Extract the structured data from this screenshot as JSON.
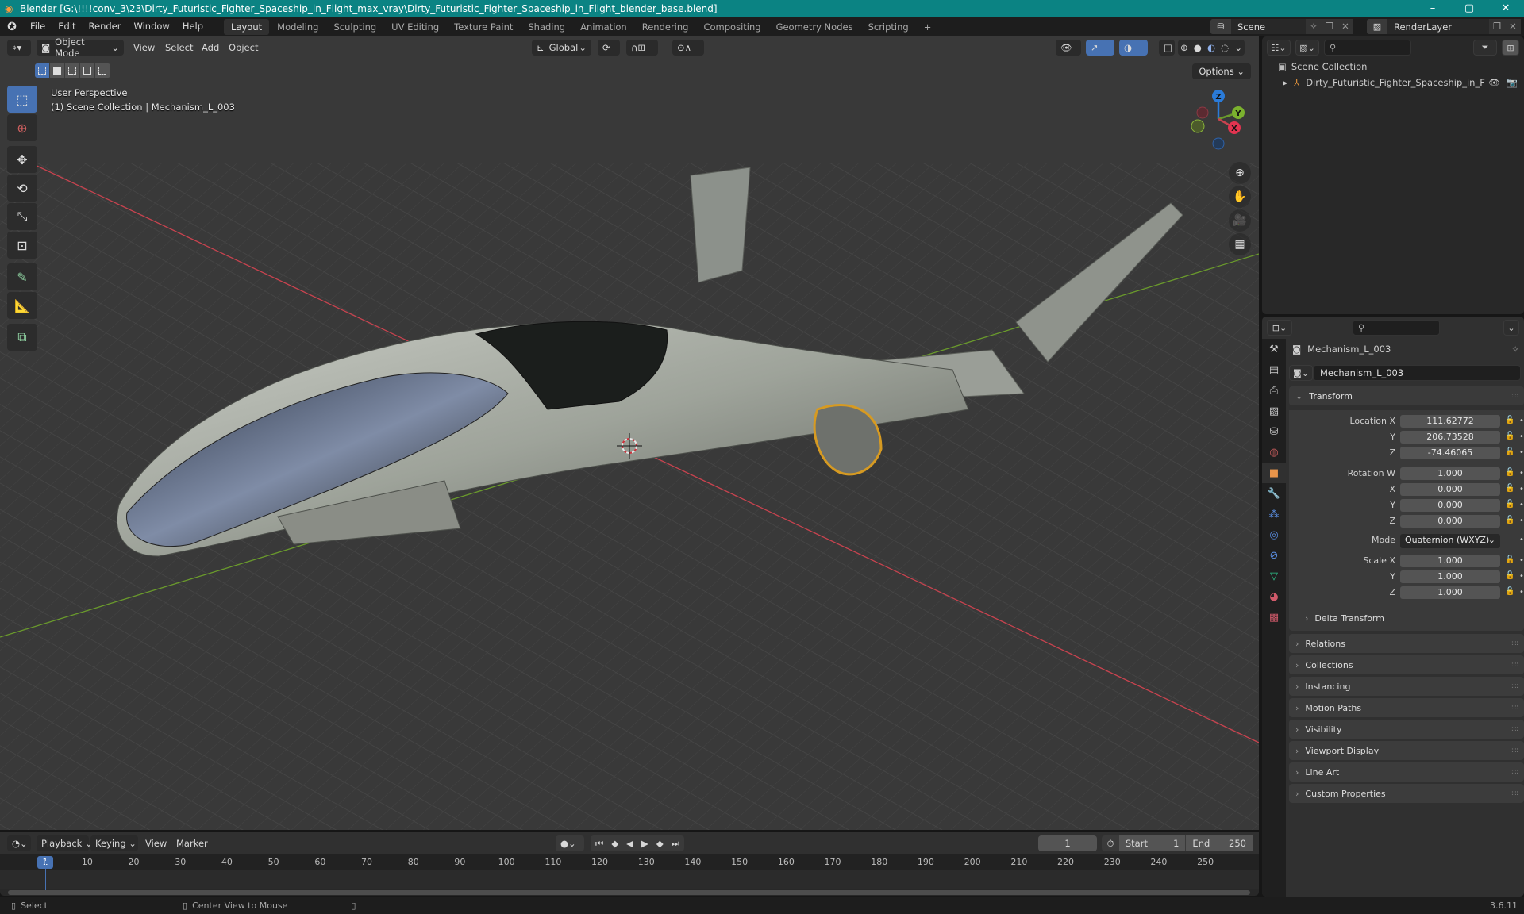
{
  "titlebar": {
    "title": "Blender [G:\\!!!!conv_3\\23\\Dirty_Futuristic_Fighter_Spaceship_in_Flight_max_vray\\Dirty_Futuristic_Fighter_Spaceship_in_Flight_blender_base.blend]",
    "minimize": "–",
    "maximize": "▢",
    "close": "✕"
  },
  "menubar": {
    "menus": [
      "File",
      "Edit",
      "Render",
      "Window",
      "Help"
    ],
    "workspaces": [
      "Layout",
      "Modeling",
      "Sculpting",
      "UV Editing",
      "Texture Paint",
      "Shading",
      "Animation",
      "Rendering",
      "Compositing",
      "Geometry Nodes",
      "Scripting"
    ],
    "active_workspace": "Layout",
    "add_workspace": "+",
    "scene": "Scene",
    "view_layer": "RenderLayer"
  },
  "viewport": {
    "mode": "Object Mode",
    "menus": [
      "View",
      "Select",
      "Add",
      "Object"
    ],
    "orientation": "Global",
    "options_label": "Options",
    "overlay_line1": "User Perspective",
    "overlay_line2": "(1) Scene Collection | Mechanism_L_003",
    "gizmo_axes": {
      "x": "X",
      "y": "Y",
      "z": "Z"
    },
    "colors": {
      "x_axis": "#c8434f",
      "y_axis": "#6a9a2c",
      "z_axis": "#2a7bd9",
      "select_blue": "#4772b3"
    }
  },
  "outliner": {
    "root": "Scene Collection",
    "items": [
      {
        "name": "Dirty_Futuristic_Fighter_Spaceship_in_F"
      }
    ]
  },
  "properties": {
    "object_name": "Mechanism_L_003",
    "data_name": "Mechanism_L_003",
    "transform_label": "Transform",
    "location": {
      "label": "Location X",
      "x": "111.62772",
      "y": "206.73528",
      "z": "-74.46065"
    },
    "rotation": {
      "label": "Rotation W",
      "w": "1.000",
      "x": "0.000",
      "y": "0.000",
      "z": "0.000"
    },
    "mode_label": "Mode",
    "mode_value": "Quaternion (WXYZ)",
    "scale": {
      "label": "Scale X",
      "x": "1.000",
      "y": "1.000",
      "z": "1.000"
    },
    "axis_labels": {
      "y": "Y",
      "z": "Z",
      "x": "X"
    },
    "delta_transform": "Delta Transform",
    "panels": [
      "Relations",
      "Collections",
      "Instancing",
      "Motion Paths",
      "Visibility",
      "Viewport Display",
      "Line Art",
      "Custom Properties"
    ]
  },
  "timeline": {
    "menus": [
      "Playback",
      "Keying",
      "View",
      "Marker"
    ],
    "current_frame": "1",
    "start_label": "Start",
    "start": "1",
    "end_label": "End",
    "end": "250",
    "ticks": [
      "10",
      "20",
      "30",
      "40",
      "50",
      "60",
      "70",
      "80",
      "90",
      "100",
      "110",
      "120",
      "130",
      "140",
      "150",
      "160",
      "170",
      "180",
      "190",
      "200",
      "210",
      "220",
      "230",
      "240",
      "250"
    ]
  },
  "statusbar": {
    "select": "Select",
    "center_view": "Center View to Mouse",
    "version": "3.6.11"
  }
}
